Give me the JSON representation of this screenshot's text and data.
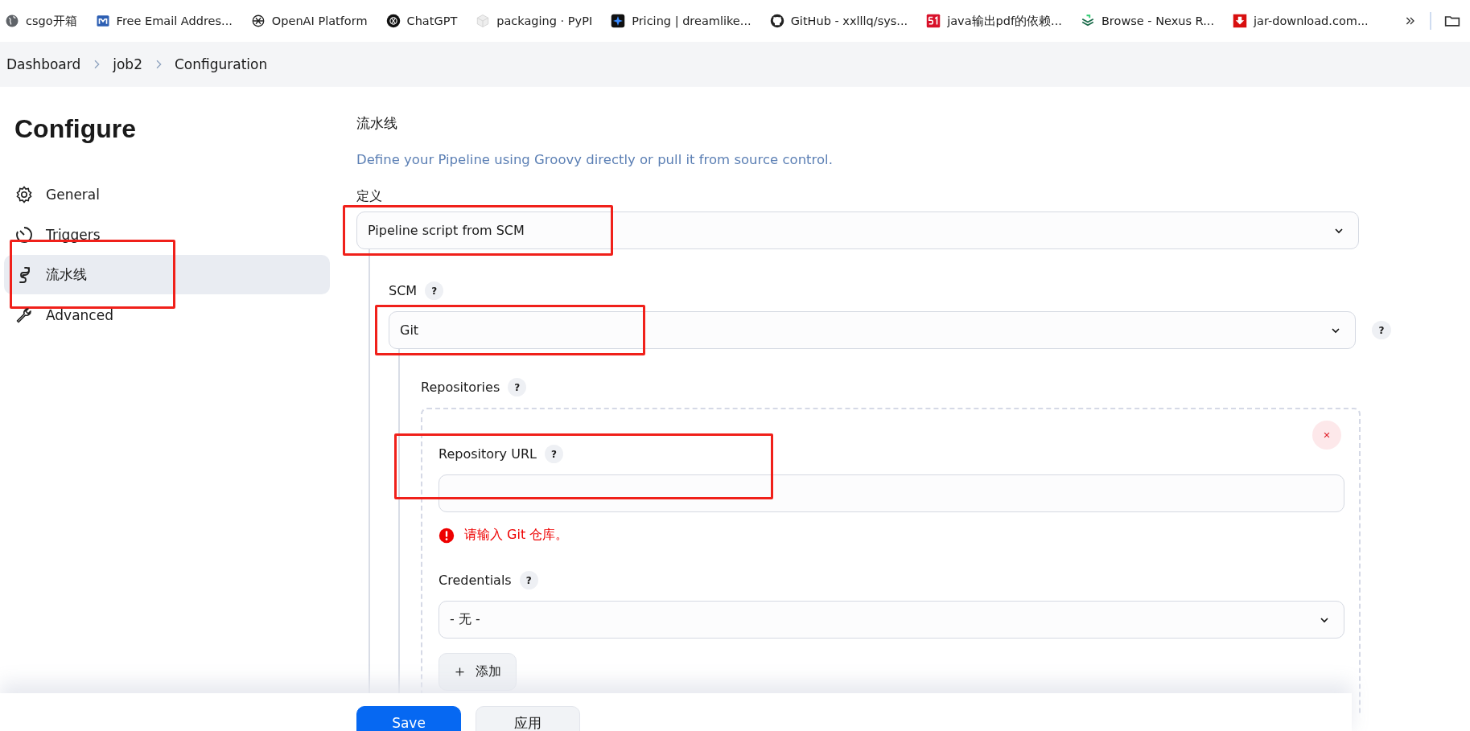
{
  "bookmarks": [
    {
      "label": "csgo开箱",
      "kind": "globe"
    },
    {
      "label": "Free Email Addres...",
      "kind": "m"
    },
    {
      "label": "OpenAI Platform",
      "kind": "knot"
    },
    {
      "label": "ChatGPT",
      "kind": "knot-dark"
    },
    {
      "label": "packaging · PyPI",
      "kind": "cube"
    },
    {
      "label": "Pricing | dreamlike...",
      "kind": "star"
    },
    {
      "label": "GitHub - xxlllq/sys...",
      "kind": "cat"
    },
    {
      "label": "java输出pdf的依赖...",
      "kind": "fifty"
    },
    {
      "label": "Browse - Nexus R...",
      "kind": "chevrons"
    },
    {
      "label": "jar-download.com...",
      "kind": "download"
    }
  ],
  "breadcrumbs": [
    "Dashboard",
    "job2",
    "Configuration"
  ],
  "sidebar": {
    "title": "Configure",
    "items": [
      {
        "label": "General",
        "kind": "gear",
        "selected": false,
        "highlighted": false
      },
      {
        "label": "Triggers",
        "kind": "timer",
        "selected": false,
        "highlighted": false
      },
      {
        "label": "流水线",
        "kind": "pipe",
        "selected": true,
        "highlighted": true
      },
      {
        "label": "Advanced",
        "kind": "wrench",
        "selected": false,
        "highlighted": false
      }
    ]
  },
  "section": {
    "title": "流水线",
    "description": "Define your Pipeline using Groovy directly or pull it from source control.",
    "definition": {
      "label": "定义",
      "value": "Pipeline script from SCM",
      "highlighted": true
    },
    "scm": {
      "label": "SCM",
      "help": "?",
      "value": "Git",
      "side_help": "?",
      "highlighted": true
    },
    "repositories": {
      "label": "Repositories",
      "help": "?",
      "url": {
        "label": "Repository URL",
        "help": "?",
        "highlighted": true,
        "error": "请输入 Git 仓库。"
      },
      "credentials": {
        "label": "Credentials",
        "help": "?",
        "value": "- 无 -"
      },
      "add_button": "添加"
    }
  },
  "footer": [
    {
      "label": "Save",
      "kind": "primary"
    },
    {
      "label": "应用",
      "kind": "secondary"
    }
  ]
}
